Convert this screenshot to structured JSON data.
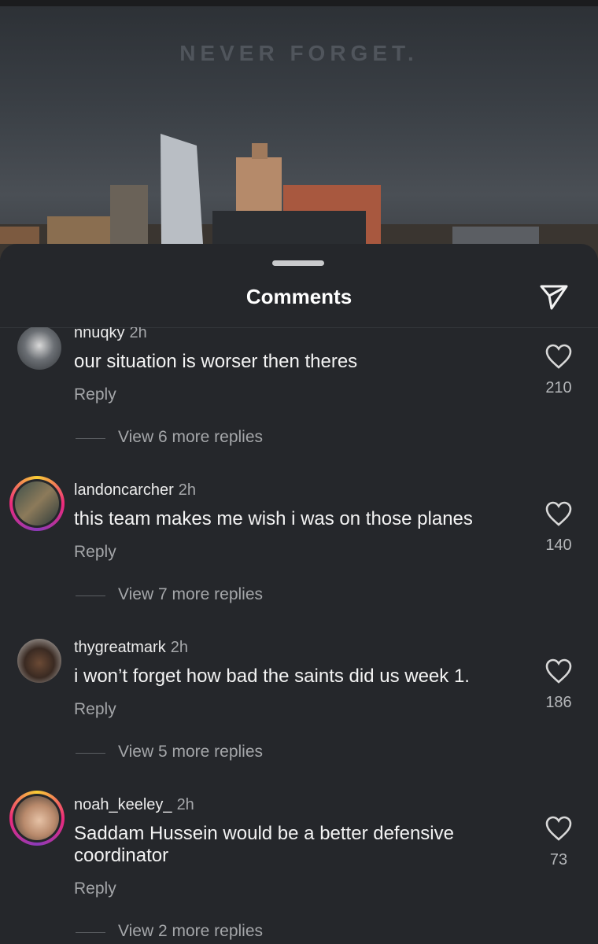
{
  "video": {
    "overlay_text": "NEVER FORGET."
  },
  "sheet": {
    "title": "Comments"
  },
  "comments": [
    {
      "username": "nnuqky",
      "time": "2h",
      "text": "our situation is worser then theres",
      "reply_label": "Reply",
      "likes": "210",
      "view_replies": "View 6 more replies"
    },
    {
      "username": "landoncarcher",
      "time": "2h",
      "text": "this team makes me wish i was on those planes",
      "reply_label": "Reply",
      "likes": "140",
      "view_replies": "View 7 more replies"
    },
    {
      "username": "thygreatmark",
      "time": "2h",
      "text": "i won’t forget how bad the saints did us week 1.",
      "reply_label": "Reply",
      "likes": "186",
      "view_replies": "View 5 more replies"
    },
    {
      "username": "noah_keeley_",
      "time": "2h",
      "text": "Saddam Hussein would be a better defensive coordinator",
      "reply_label": "Reply",
      "likes": "73",
      "view_replies": "View 2 more replies"
    }
  ],
  "colors": {
    "sheet_bg": "#25272b",
    "story_ring": "#ee2a7b"
  },
  "icons": {
    "send": "send-icon",
    "like": "heart-icon"
  }
}
